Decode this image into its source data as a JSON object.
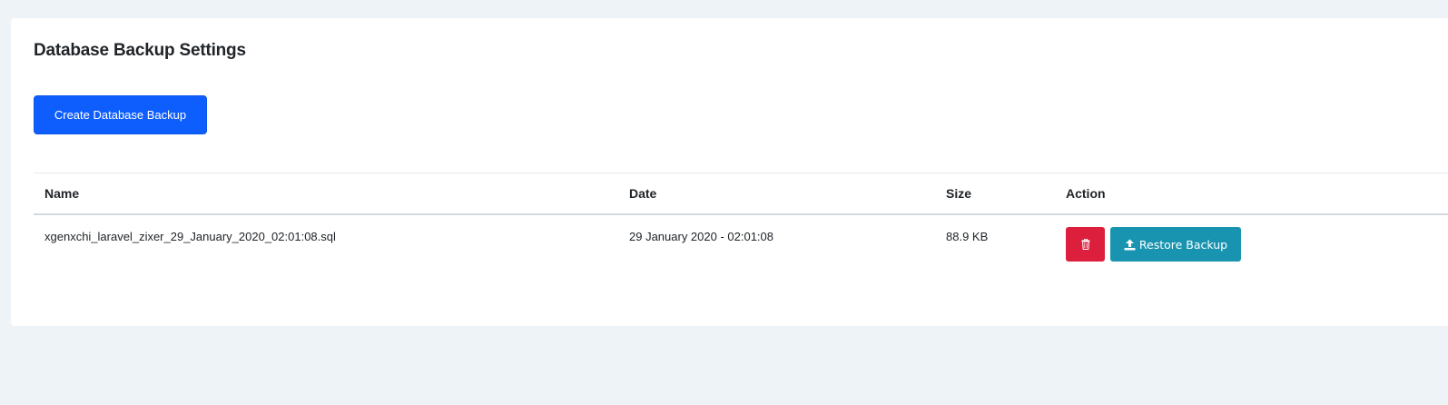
{
  "card": {
    "title": "Database Backup Settings",
    "create_button_label": "Create Database Backup"
  },
  "table": {
    "columns": [
      "Name",
      "Date",
      "Size",
      "Action"
    ],
    "rows": [
      {
        "name": "xgenxchi_laravel_zixer_29_January_2020_02:01:08.sql",
        "date": "29 January 2020 - 02:01:08",
        "size": "88.9 KB",
        "delete_icon": "trash-icon",
        "restore_icon": "upload-icon",
        "restore_label": "Restore Backup"
      }
    ]
  },
  "colors": {
    "background": "#eef3f7",
    "primary": "#0d5efd",
    "danger": "#dc1f3c",
    "info": "#1994b0"
  }
}
